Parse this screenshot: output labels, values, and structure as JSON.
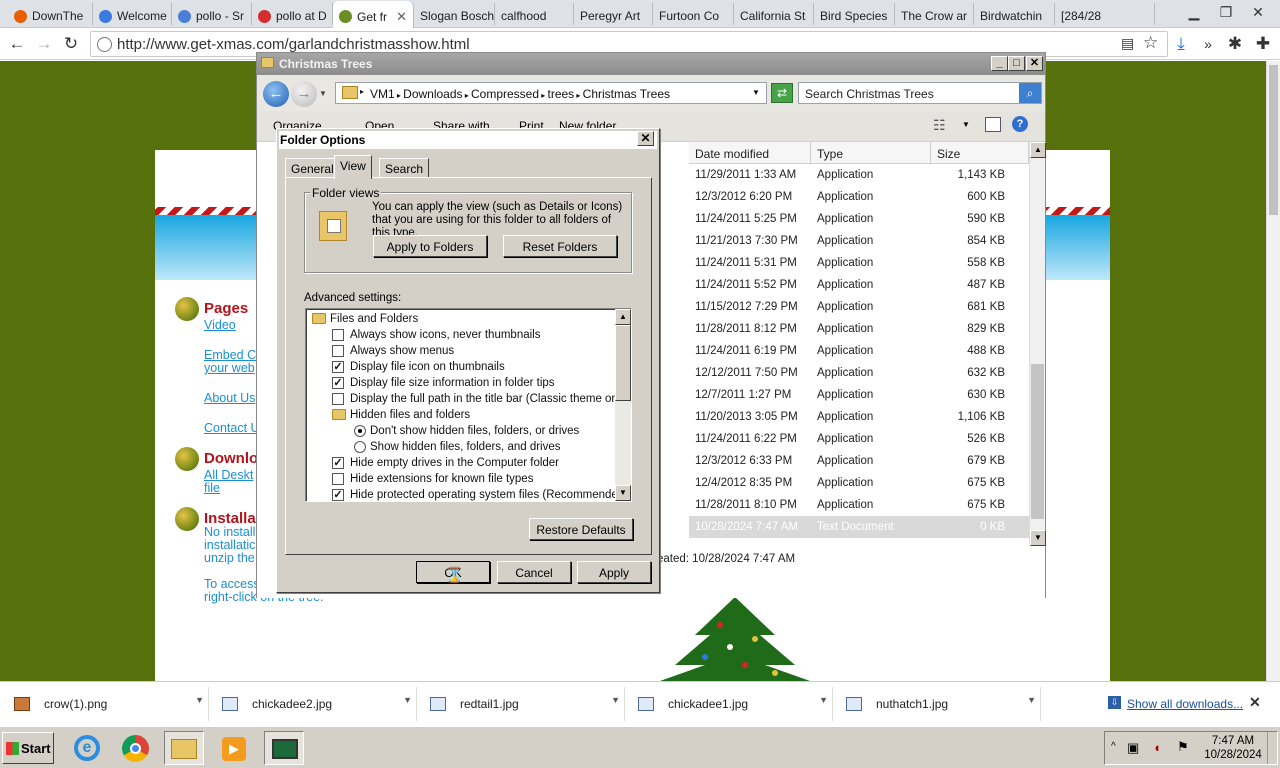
{
  "browser": {
    "tabs": [
      {
        "label": "DownThe",
        "icon": "firefox-icon"
      },
      {
        "label": "Welcome",
        "icon": "loading-icon"
      },
      {
        "label": "pollo - Sr",
        "icon": "search-icon"
      },
      {
        "label": "pollo at D",
        "icon": "opera-icon"
      },
      {
        "label": "Get fr",
        "icon": "tree-icon",
        "active": true
      },
      {
        "label": "Slogan Bosch",
        "icon": ""
      },
      {
        "label": "calfhood",
        "icon": ""
      },
      {
        "label": "Peregyr Art",
        "icon": ""
      },
      {
        "label": "Furtoon Co",
        "icon": ""
      },
      {
        "label": "California St",
        "icon": ""
      },
      {
        "label": "Bird Species",
        "icon": ""
      },
      {
        "label": "The Crow ar",
        "icon": ""
      },
      {
        "label": "Birdwatchin",
        "icon": ""
      },
      {
        "label": "[284/28",
        "icon": ""
      }
    ],
    "url": "http://www.get-xmas.com/garlandchristmasshow.html"
  },
  "webpage": {
    "pages_heading": "Pages",
    "links": [
      "Video",
      "Embed C",
      "your web",
      "About Us",
      "Contact U"
    ],
    "downloads_heading": "Downlo",
    "download_links": [
      "All Deskt",
      "file"
    ],
    "install_heading": "Installa",
    "install_text": [
      "No install",
      "installatic",
      "unzip the",
      "To access",
      "right-click on the tree."
    ]
  },
  "explorer": {
    "title": "Christmas Trees",
    "breadcrumbs": [
      "VM1",
      "Downloads",
      "Compressed",
      "trees",
      "Christmas Trees"
    ],
    "search_placeholder": "Search Christmas Trees",
    "toolbar": [
      "Organize",
      "Open",
      "Share with",
      "Print",
      "New folder"
    ],
    "columns": [
      "Date modified",
      "Type",
      "Size"
    ],
    "files": [
      {
        "date": "11/29/2011 1:33 AM",
        "type": "Application",
        "size": "1,143 KB"
      },
      {
        "date": "12/3/2012 6:20 PM",
        "type": "Application",
        "size": "600 KB"
      },
      {
        "date": "11/24/2011 5:25 PM",
        "type": "Application",
        "size": "590 KB"
      },
      {
        "date": "11/21/2013 7:30 PM",
        "type": "Application",
        "size": "854 KB"
      },
      {
        "date": "11/24/2011 5:31 PM",
        "type": "Application",
        "size": "558 KB"
      },
      {
        "date": "11/24/2011 5:52 PM",
        "type": "Application",
        "size": "487 KB"
      },
      {
        "date": "11/15/2012 7:29 PM",
        "type": "Application",
        "size": "681 KB"
      },
      {
        "date": "11/28/2011 8:12 PM",
        "type": "Application",
        "size": "829 KB"
      },
      {
        "date": "11/24/2011 6:19 PM",
        "type": "Application",
        "size": "488 KB"
      },
      {
        "date": "12/12/2011 7:50 PM",
        "type": "Application",
        "size": "632 KB"
      },
      {
        "date": "12/7/2011 1:27 PM",
        "type": "Application",
        "size": "630 KB"
      },
      {
        "date": "11/20/2013 3:05 PM",
        "type": "Application",
        "size": "1,106 KB"
      },
      {
        "date": "11/24/2011 6:22 PM",
        "type": "Application",
        "size": "526 KB"
      },
      {
        "date": "12/3/2012 6:33 PM",
        "type": "Application",
        "size": "679 KB"
      },
      {
        "date": "12/4/2012 8:35 PM",
        "type": "Application",
        "size": "675 KB"
      },
      {
        "date": "11/28/2011 8:10 PM",
        "type": "Application",
        "size": "675 KB"
      },
      {
        "date": "10/28/2024 7:47 AM",
        "type": "Text Document",
        "size": "0 KB",
        "selected": true
      }
    ],
    "status": "eated: 10/28/2024 7:47 AM"
  },
  "dialog": {
    "title": "Folder Options",
    "close": "✕",
    "tabs": [
      "General",
      "View",
      "Search"
    ],
    "folder_views_label": "Folder views",
    "folder_views_text": "You can apply the view (such as Details or Icons) that you are using for this folder to all folders of this type.",
    "apply_to_folders": "Apply to Folders",
    "reset_folders": "Reset Folders",
    "advanced_label": "Advanced settings:",
    "advanced_items": [
      {
        "kind": "folder",
        "indent": 0,
        "label": "Files and Folders"
      },
      {
        "kind": "check",
        "indent": 1,
        "checked": false,
        "label": "Always show icons, never thumbnails"
      },
      {
        "kind": "check",
        "indent": 1,
        "checked": false,
        "label": "Always show menus"
      },
      {
        "kind": "check",
        "indent": 1,
        "checked": true,
        "label": "Display file icon on thumbnails"
      },
      {
        "kind": "check",
        "indent": 1,
        "checked": true,
        "label": "Display file size information in folder tips"
      },
      {
        "kind": "check",
        "indent": 1,
        "checked": false,
        "label": "Display the full path in the title bar (Classic theme only)"
      },
      {
        "kind": "folder",
        "indent": 1,
        "label": "Hidden files and folders"
      },
      {
        "kind": "radio",
        "indent": 2,
        "checked": true,
        "label": "Don't show hidden files, folders, or drives"
      },
      {
        "kind": "radio",
        "indent": 2,
        "checked": false,
        "label": "Show hidden files, folders, and drives"
      },
      {
        "kind": "check",
        "indent": 1,
        "checked": true,
        "label": "Hide empty drives in the Computer folder"
      },
      {
        "kind": "check",
        "indent": 1,
        "checked": false,
        "label": "Hide extensions for known file types"
      },
      {
        "kind": "check",
        "indent": 1,
        "checked": true,
        "label": "Hide protected operating system files (Recommended)"
      }
    ],
    "restore_defaults": "Restore Defaults",
    "ok": "OK",
    "cancel": "Cancel",
    "apply": "Apply"
  },
  "downloads": {
    "items": [
      "crow(1).png",
      "chickadee2.jpg",
      "redtail1.jpg",
      "chickadee1.jpg",
      "nuthatch1.jpg"
    ],
    "show_all": "Show all downloads..."
  },
  "taskbar": {
    "start": "Start",
    "time": "7:47 AM",
    "date": "10/28/2024"
  },
  "colors": {
    "page_green": "#56710b",
    "link_blue": "#1a8fd8",
    "heading_red": "#b3141b"
  }
}
